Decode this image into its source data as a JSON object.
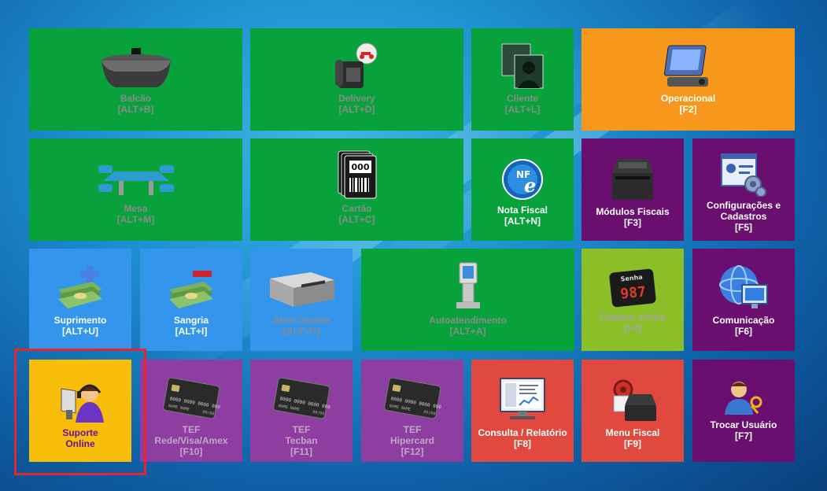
{
  "tiles": {
    "balcao": {
      "label": "Balcão",
      "key": "[ALT+B]",
      "icon": "counter-desk-icon"
    },
    "delivery": {
      "label": "Delivery",
      "key": "[ALT+D]",
      "icon": "phone-motorbike-icon"
    },
    "cliente": {
      "label": "Cliente",
      "key": "[ALT+L]",
      "icon": "customer-photos-icon"
    },
    "operacional": {
      "label": "Operacional",
      "key": "[F2]",
      "icon": "control-panel-icon"
    },
    "mesa": {
      "label": "Mesa",
      "key": "[ALT+M]",
      "icon": "table-chairs-icon"
    },
    "cartao": {
      "label": "Cartão",
      "key": "[ALT+C]",
      "icon": "tag-cards-icon",
      "card_number": "000"
    },
    "nota_fiscal": {
      "label": "Nota Fiscal",
      "key": "[ALT+N]",
      "icon": "nfe-globe-icon",
      "badge": "NF",
      "badge_letter": "e"
    },
    "modulos_fiscais": {
      "label": "Módulos Fiscais",
      "key": "[F3]",
      "icon": "fiscal-printer-icon"
    },
    "configuracoes": {
      "label": "Configurações e\nCadastros",
      "key": "[F5]",
      "icon": "settings-gears-icon"
    },
    "suprimento": {
      "label": "Suprimento",
      "key": "[ALT+U]",
      "icon": "money-plus-icon"
    },
    "sangria": {
      "label": "Sangria",
      "key": "[ALT+I]",
      "icon": "money-minus-icon"
    },
    "abrir_gaveta": {
      "label": "Abrir Gaveta",
      "key": "[ALT+G]",
      "icon": "cash-drawer-icon"
    },
    "autoatendimento": {
      "label": "Autoatendimento",
      "key": "[ALT+A]",
      "icon": "kiosk-icon"
    },
    "chamar_senha": {
      "label": "Chamar senha",
      "key": "[F4]",
      "icon": "ticket-display-icon",
      "display_title": "Senha",
      "display_number": "987"
    },
    "comunicacao": {
      "label": "Comunicação",
      "key": "[F6]",
      "icon": "globe-monitor-icon"
    },
    "suporte_online": {
      "label": "Suporte\nOnline",
      "key": "",
      "icon": "support-agent-icon"
    },
    "tef_rede": {
      "label": "TEF\nRede/Visa/Amex",
      "key": "[F10]",
      "icon": "credit-card-icon"
    },
    "tef_tecban": {
      "label": "TEF\nTecban",
      "key": "[F11]",
      "icon": "credit-card-icon"
    },
    "tef_hipercard": {
      "label": "TEF\nHipercard",
      "key": "[F12]",
      "icon": "credit-card-icon"
    },
    "consulta_relatorio": {
      "label": "Consulta / Relatório",
      "key": "[F8]",
      "icon": "report-monitor-icon"
    },
    "menu_fiscal": {
      "label": "Menu Fiscal",
      "key": "[F9]",
      "icon": "fiscal-printer-gear-icon"
    },
    "trocar_usuario": {
      "label": "Trocar Usuário",
      "key": "[F7]",
      "icon": "user-key-icon"
    }
  },
  "card_art": {
    "number": "0000 0000 0000 0000",
    "name": "NAME NAME",
    "expiry": "00/00"
  },
  "colors": {
    "green": "#07a23c",
    "orange": "#f7981d",
    "purple": "#6a0f70",
    "blue": "#3396ec",
    "lime": "#8bbf28",
    "violet": "#8e3ea0",
    "red": "#e1483e",
    "yellow": "#f8bd08",
    "highlight": "#e5262d"
  }
}
